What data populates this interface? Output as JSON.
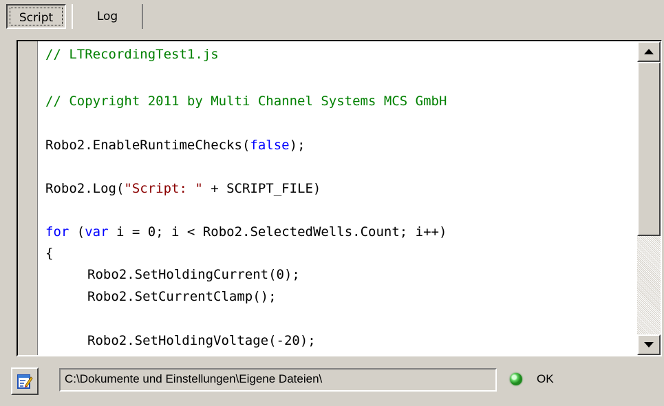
{
  "tabs": [
    {
      "label": "Script",
      "active": true
    },
    {
      "label": "Log",
      "active": false
    }
  ],
  "editor": {
    "lines": {
      "l1": "// LTRecordingTest1.js",
      "l3": "// Copyright 2011 by Multi Channel Systems MCS GmbH",
      "l5a": "Robo2.EnableRuntimeChecks(",
      "l5b": "false",
      "l5c": ");",
      "l7a": "Robo2.Log(",
      "l7b": "\"Script: \"",
      "l7c": " + SCRIPT_FILE)",
      "l9a": "for",
      "l9b": " (",
      "l9c": "var",
      "l9d": " i = 0; i < Robo2.SelectedWells.Count; i++)",
      "l10": "{",
      "l11": "Robo2.SetHoldingCurrent(0);",
      "l12": "Robo2.SetCurrentClamp();",
      "l14": "Robo2.SetHoldingVoltage(-20);"
    },
    "syntax_colors": {
      "comment": "#008000",
      "keyword": "#0000ff",
      "string": "#8b0000"
    }
  },
  "statusbar": {
    "path": "C:\\Dokumente und Einstellungen\\Eigene Dateien\\",
    "status_text": "OK",
    "status_led_color": "#3cc83c"
  },
  "icons": {
    "edit_button": "edit-script-icon",
    "status_led": "status-led-icon"
  }
}
